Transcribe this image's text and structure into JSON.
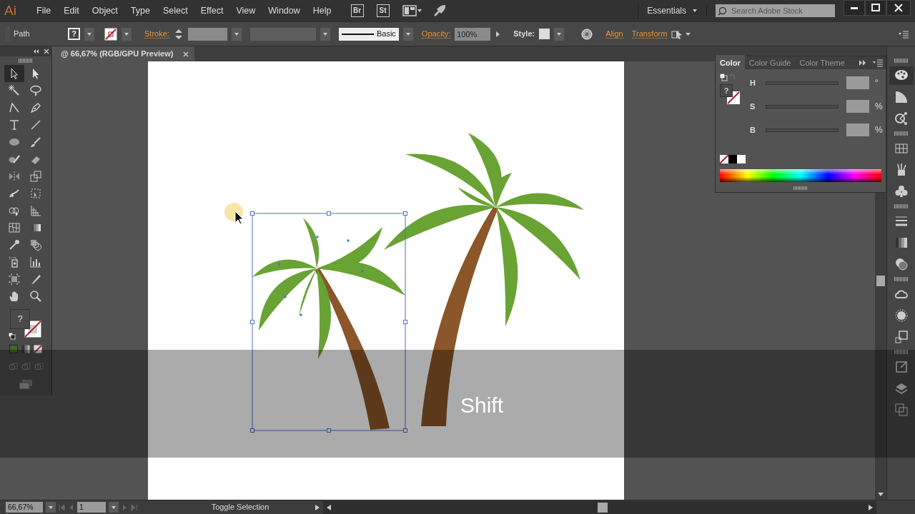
{
  "app_logo": "Ai",
  "menu": [
    "File",
    "Edit",
    "Object",
    "Type",
    "Select",
    "Effect",
    "View",
    "Window",
    "Help"
  ],
  "bridge_button": "Br",
  "stock_button": "St",
  "workspace": "Essentials",
  "search": {
    "placeholder": "Search Adobe Stock"
  },
  "control_bar": {
    "selection": "Path",
    "fill_swatch": "?",
    "stroke_label": "Stroke:",
    "stroke_profile": "Basic",
    "opacity_label": "Opacity:",
    "opacity": "100%",
    "style_label": "Style:",
    "align": "Align",
    "transform": "Transform"
  },
  "document_tab": {
    "title": "@ 66,67% (RGB/GPU Preview)"
  },
  "tools": [
    {
      "kind": "selection",
      "selected": true
    },
    {
      "kind": "direct",
      "selected": false
    },
    {
      "kind": "wand",
      "selected": false
    },
    {
      "kind": "lasso",
      "selected": false
    },
    {
      "kind": "curvature",
      "selected": false
    },
    {
      "kind": "pen",
      "selected": false
    },
    {
      "kind": "type",
      "selected": false
    },
    {
      "kind": "line",
      "selected": false
    },
    {
      "kind": "ellipse",
      "selected": false
    },
    {
      "kind": "brush",
      "selected": false
    },
    {
      "kind": "shaper",
      "selected": false
    },
    {
      "kind": "eraser",
      "selected": false
    },
    {
      "kind": "reflect",
      "selected": false
    },
    {
      "kind": "scale",
      "selected": false
    },
    {
      "kind": "warp",
      "selected": false
    },
    {
      "kind": "free",
      "selected": false
    },
    {
      "kind": "shapebuilder",
      "selected": false
    },
    {
      "kind": "perspective",
      "selected": false
    },
    {
      "kind": "mesh",
      "selected": false
    },
    {
      "kind": "gradient",
      "selected": false
    },
    {
      "kind": "eyedropper",
      "selected": false
    },
    {
      "kind": "blend",
      "selected": false
    },
    {
      "kind": "spray",
      "selected": false
    },
    {
      "kind": "graph",
      "selected": false
    },
    {
      "kind": "artboard",
      "selected": false
    },
    {
      "kind": "slice",
      "selected": false
    },
    {
      "kind": "hand",
      "selected": false
    },
    {
      "kind": "zoom",
      "selected": false
    }
  ],
  "fill_stroke": {
    "fill": "?"
  },
  "color_panel": {
    "tabs": [
      {
        "label": "Color",
        "selected": true
      },
      {
        "label": "Color Guide",
        "selected": false
      },
      {
        "label": "Color Theme",
        "selected": false
      }
    ],
    "fill": "?",
    "sliders": [
      {
        "label": "H",
        "unit": "°"
      },
      {
        "label": "S",
        "unit": "%"
      },
      {
        "label": "B",
        "unit": "%"
      }
    ]
  },
  "dock": [
    {
      "kind": "palette",
      "selected": true
    },
    {
      "kind": "quarter",
      "selected": false
    },
    {
      "kind": "guide",
      "selected": false
    },
    {
      "kind": "swatches",
      "selected": false
    },
    {
      "kind": "brushes",
      "selected": false
    },
    {
      "kind": "club",
      "selected": false
    },
    {
      "kind": "stroke",
      "selected": false
    },
    {
      "kind": "gradient",
      "selected": false
    },
    {
      "kind": "transparency",
      "selected": false
    },
    {
      "kind": "libraries",
      "selected": false
    },
    {
      "kind": "appearance",
      "selected": false
    },
    {
      "kind": "transform",
      "selected": false
    },
    {
      "kind": "export",
      "selected": false
    },
    {
      "kind": "layers",
      "selected": false
    },
    {
      "kind": "artboards",
      "selected": false
    }
  ],
  "keystroke_overlay": "Shift",
  "status_bar": {
    "zoom": "66,67%",
    "artboard": "1",
    "tool_status": "Toggle Selection"
  }
}
